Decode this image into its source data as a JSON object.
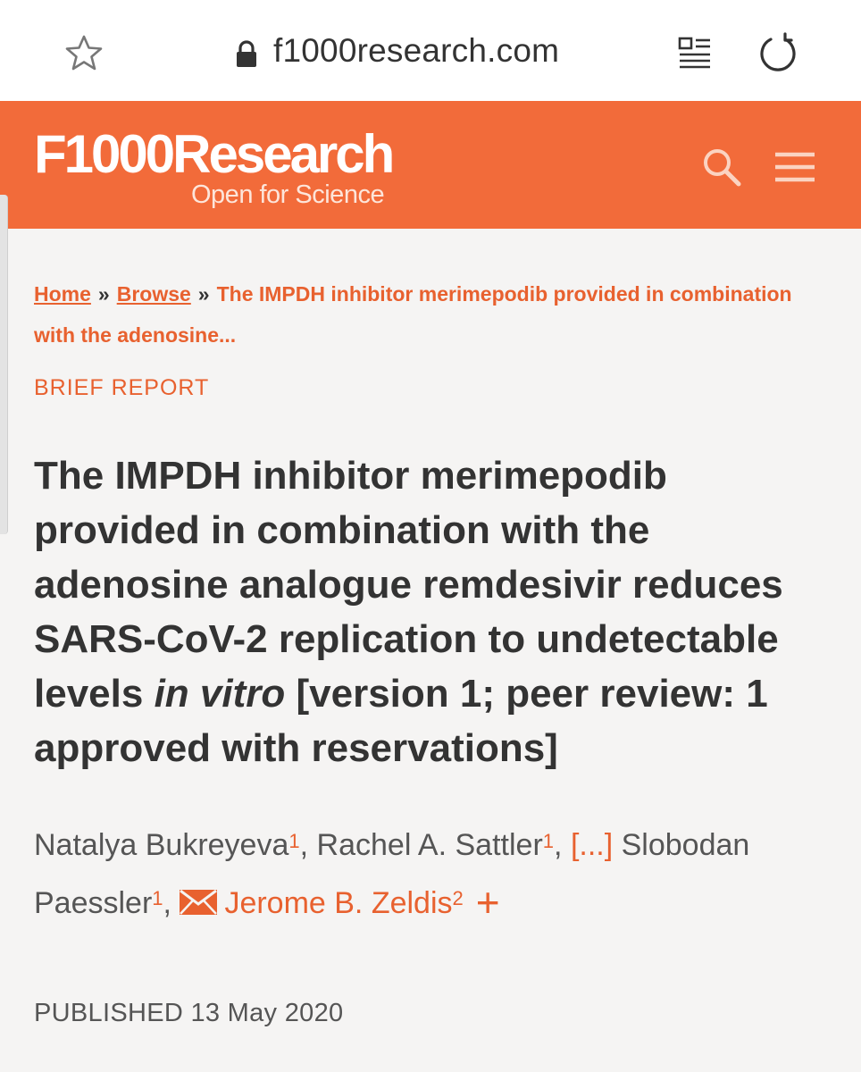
{
  "browser": {
    "url": "f1000research.com"
  },
  "header": {
    "logo_main": "F1000Research",
    "logo_tagline": "Open for Science",
    "brand_color": "#f26b3a"
  },
  "breadcrumb": {
    "home": "Home",
    "separator": "»",
    "browse": "Browse",
    "current": "The IMPDH inhibitor merimepodib provided in combination with the adenosine..."
  },
  "article": {
    "type": "BRIEF REPORT",
    "title_part1": "The IMPDH inhibitor merimepodib provided in combination with the adenosine analogue remdesivir reduces SARS-CoV-2 replication to undetectable levels ",
    "title_italic": "in vitro",
    "title_part2": " [version 1; peer review: 1 approved with reservations]",
    "authors": [
      {
        "name": "Natalya Bukreyeva",
        "affiliation": "1"
      },
      {
        "name": "Rachel A. Sattler",
        "affiliation": "1"
      },
      {
        "name": "Slobodan Paessler",
        "affiliation": "1"
      },
      {
        "name": "Jerome B. Zeldis",
        "affiliation": "2"
      }
    ],
    "authors_more": "[...]",
    "expand_symbol": "+",
    "published_label": "PUBLISHED",
    "published_date": "13 May 2020"
  }
}
